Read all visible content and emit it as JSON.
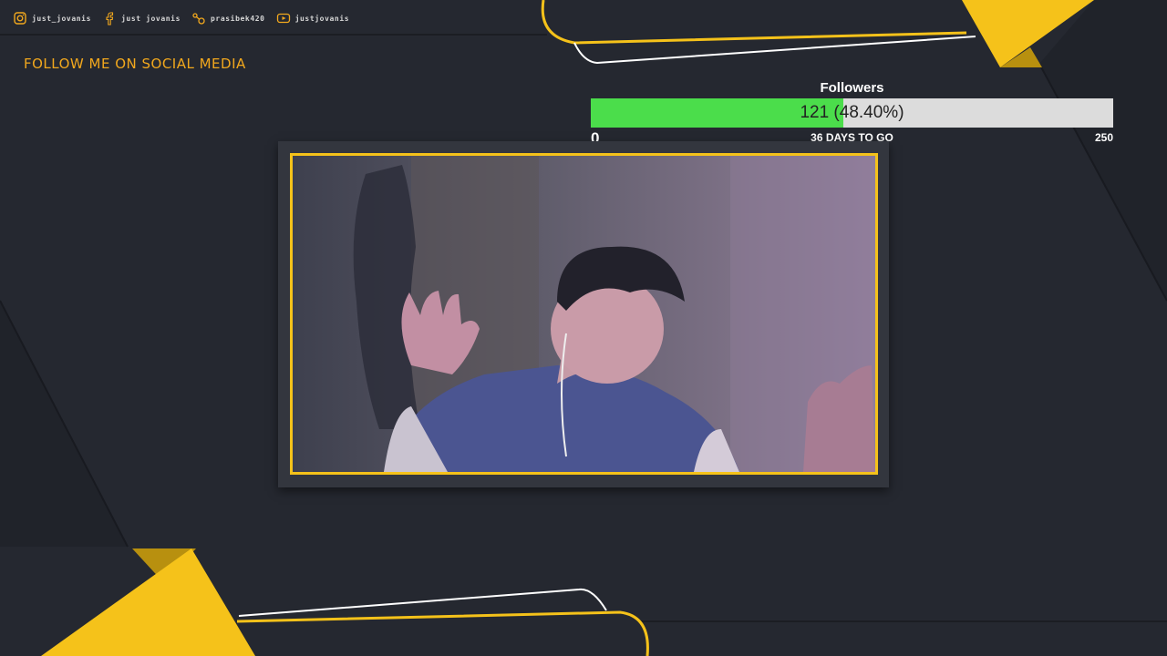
{
  "colors": {
    "background": "#252830",
    "accent_yellow": "#f5c21a",
    "heading_orange": "#f2a81d",
    "progress_green": "#4bdd4b",
    "progress_track": "#dcdcdc"
  },
  "social": {
    "items": [
      {
        "icon": "instagram-icon",
        "label": "just_jovanis"
      },
      {
        "icon": "facebook-icon",
        "label": "just jovanis"
      },
      {
        "icon": "steam-icon",
        "label": "prasibek420"
      },
      {
        "icon": "youtube-icon",
        "label": "justjovanis"
      }
    ]
  },
  "heading": "FOLLOW ME ON SOCIAL MEDIA",
  "goal": {
    "title": "Followers",
    "current": 121,
    "target": 250,
    "progress_fraction": 0.484,
    "value_text": "121 (48.40%)",
    "min_label": "0",
    "max_label": "250",
    "days_text": "36 DAYS TO GO"
  }
}
